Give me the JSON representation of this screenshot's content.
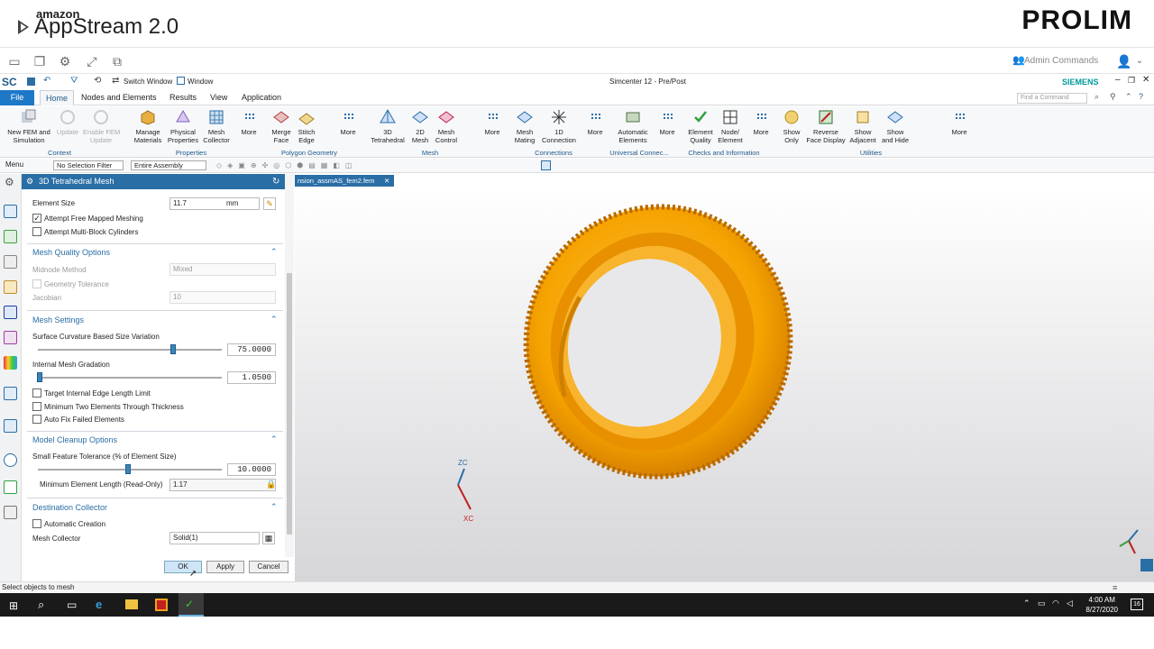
{
  "banner": {
    "amazon": "amazon",
    "appstream": "AppStream 2.0",
    "brand": "PROLIM",
    "admin_commands": "Admin Commands"
  },
  "qat": {
    "logo": "SC",
    "switch_window": "Switch Window",
    "window": "Window",
    "app_title": "Simcenter 12 - Pre/Post",
    "siemens": "SIEMENS"
  },
  "tabs": [
    "File",
    "Home",
    "Nodes and Elements",
    "Results",
    "View",
    "Application"
  ],
  "find_command_placeholder": "Find a Command",
  "ribbon": {
    "buttons": [
      {
        "label": "New FEM and\nSimulation",
        "enabled": true
      },
      {
        "label": "Update",
        "enabled": false
      },
      {
        "label": "Enable FEM\nUpdate",
        "enabled": false
      },
      {
        "label": "Manage\nMaterials",
        "enabled": true
      },
      {
        "label": "Physical\nProperties",
        "enabled": true
      },
      {
        "label": "Mesh\nCollector",
        "enabled": true
      },
      {
        "label": "More",
        "enabled": true
      },
      {
        "label": "Merge\nFace",
        "enabled": true
      },
      {
        "label": "Stitch\nEdge",
        "enabled": true
      },
      {
        "label": "More",
        "enabled": true
      },
      {
        "label": "3D\nTetrahedral",
        "enabled": true
      },
      {
        "label": "2D\nMesh",
        "enabled": true
      },
      {
        "label": "Mesh\nControl",
        "enabled": true
      },
      {
        "label": "More",
        "enabled": true
      },
      {
        "label": "Mesh\nMating",
        "enabled": true
      },
      {
        "label": "1D\nConnection",
        "enabled": true
      },
      {
        "label": "More",
        "enabled": true
      },
      {
        "label": "Automatic\nElements",
        "enabled": true
      },
      {
        "label": "More",
        "enabled": true
      },
      {
        "label": "Element\nQuality",
        "enabled": true
      },
      {
        "label": "Node/\nElement",
        "enabled": true
      },
      {
        "label": "More",
        "enabled": true
      },
      {
        "label": "Show\nOnly",
        "enabled": true
      },
      {
        "label": "Reverse\nFace Display",
        "enabled": true
      },
      {
        "label": "Show\nAdjacent",
        "enabled": true
      },
      {
        "label": "Show\nand Hide",
        "enabled": true
      },
      {
        "label": "More",
        "enabled": true
      }
    ],
    "groups": [
      "Context",
      "Properties",
      "Polygon Geometry",
      "Mesh",
      "Connections",
      "Universal Connec...",
      "Checks and Information",
      "Utilities"
    ]
  },
  "filterbar": {
    "menu": "Menu",
    "selection_filter": "No Selection Filter",
    "assembly": "Entire Assembly"
  },
  "dialog": {
    "title": "3D Tetrahedral Mesh",
    "element_size_label": "Element Size",
    "element_size_value": "11.7",
    "element_size_unit": "mm",
    "attempt_free_mapped": "Attempt Free Mapped Meshing",
    "attempt_multiblock": "Attempt Multi-Block Cylinders",
    "sec_quality": "Mesh Quality Options",
    "midnode_label": "Midnode Method",
    "midnode_value": "Mixed",
    "geom_tolerance": "Geometry Tolerance",
    "jacobian_label": "Jacobian",
    "jacobian_value": "10",
    "sec_settings": "Mesh Settings",
    "curv_label": "Surface Curvature Based Size Variation",
    "curv_value": "75.0000",
    "curv_fraction": 0.75,
    "gradation_label": "Internal Mesh Gradation",
    "gradation_value": "1.0500",
    "gradation_fraction": 0.01,
    "target_edge": "Target Internal Edge Length Limit",
    "min_two": "Minimum Two Elements Through Thickness",
    "auto_fix": "Auto Fix Failed Elements",
    "sec_cleanup": "Model Cleanup Options",
    "small_feature_label": "Small Feature Tolerance (% of Element Size)",
    "small_feature_value": "10.0000",
    "small_feature_fraction": 0.5,
    "min_elem_label": "Minimum Element Length (Read-Only)",
    "min_elem_value": "1.17",
    "sec_dest": "Destination Collector",
    "auto_creation": "Automatic Creation",
    "mesh_collector_label": "Mesh Collector",
    "mesh_collector_value": "Solid(1)",
    "ok": "OK",
    "apply": "Apply",
    "cancel": "Cancel"
  },
  "doc_tab": "nsion_assmAS_fem2.fem",
  "triad": {
    "zc": "ZC",
    "xc": "XC"
  },
  "status": "Select objects to mesh",
  "clock": {
    "time": "4:00 AM",
    "date": "8/27/2020"
  },
  "notification_count": "16",
  "colors": {
    "accent": "#2a6ea6",
    "file_tab": "#1e78c8",
    "tire": "#f5a300",
    "siemens": "#009999"
  }
}
